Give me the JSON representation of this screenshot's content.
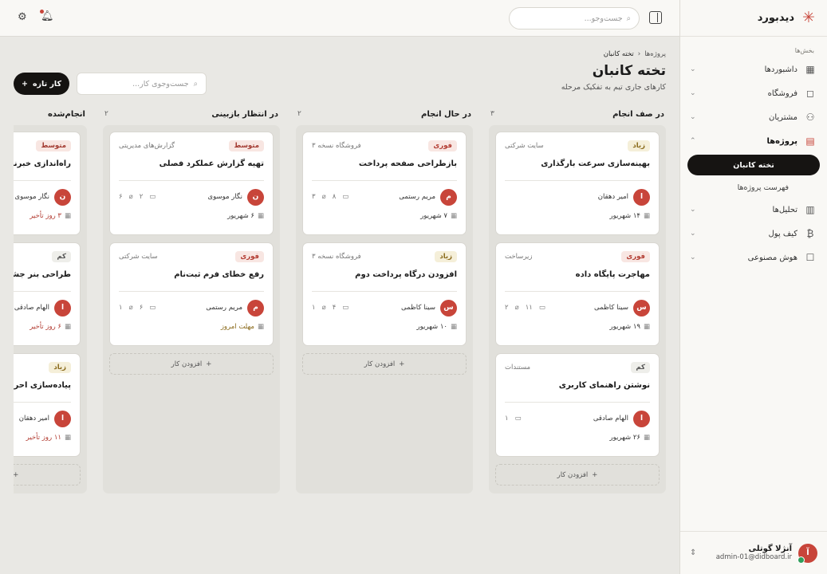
{
  "app": {
    "name": "دیدبورد"
  },
  "sidebar": {
    "section_label": "بخش‌ها",
    "items": [
      {
        "label": "داشبوردها",
        "icon": "grid-icon"
      },
      {
        "label": "فروشگاه",
        "icon": "bag-icon"
      },
      {
        "label": "مشتریان",
        "icon": "users-icon"
      },
      {
        "label": "پروژه‌ها",
        "icon": "kanban-icon"
      },
      {
        "label": "تحلیل‌ها",
        "icon": "bar-chart-icon"
      },
      {
        "label": "کیف پول",
        "icon": "bitcoin-icon"
      },
      {
        "label": "هوش مصنوعی",
        "icon": "robot-icon"
      }
    ],
    "sub_items": [
      {
        "label": "تخته کانبان"
      },
      {
        "label": "فهرست پروژه‌ها"
      }
    ],
    "user": {
      "name": "آنژلا گوتلی",
      "email": "admin-01@didboard.ir",
      "initial": "آ"
    }
  },
  "topbar": {
    "search_placeholder": "جست‌وجو..."
  },
  "page": {
    "breadcrumb_parent": "پروژه‌ها",
    "breadcrumb_current": "تخته کانبان",
    "title": "تخته کانبان",
    "subtitle": "کارهای جاری تیم به تفکیک مرحله",
    "search_placeholder": "جست‌وجوی کار...",
    "new_task_label": "کار تازه",
    "add_card_label": "افزودن کار"
  },
  "columns": [
    {
      "title": "در صف انجام",
      "count": "۳",
      "cards": [
        {
          "tag": "زیاد",
          "project": "سایت شرکتی",
          "title": "بهینه‌سازی سرعت بارگذاری",
          "assignee": "امیر دهقان",
          "initial": "ا",
          "comments": "",
          "attachments": "",
          "date": "۱۴ شهریور"
        },
        {
          "tag": "فوری",
          "project": "زیرساخت",
          "title": "مهاجرت پایگاه داده",
          "assignee": "سینا کاظمی",
          "initial": "س",
          "comments": "۱۱",
          "attachments": "۲",
          "date": "۱۹ شهریور"
        },
        {
          "tag": "کم",
          "project": "مستندات",
          "title": "نوشتن راهنمای کاربری",
          "assignee": "الهام صادقی",
          "initial": "ا",
          "comments": "۱",
          "attachments": "",
          "date": "۲۶ شهریور"
        }
      ]
    },
    {
      "title": "در حال انجام",
      "count": "۲",
      "cards": [
        {
          "tag": "فوری",
          "project": "فروشگاه نسخه ۳",
          "title": "بازطراحی صفحه پرداخت",
          "assignee": "مریم رستمی",
          "initial": "م",
          "comments": "۸",
          "attachments": "۳",
          "date": "۷ شهریور"
        },
        {
          "tag": "زیاد",
          "project": "فروشگاه نسخه ۳",
          "title": "افزودن درگاه پرداخت دوم",
          "assignee": "سینا کاظمی",
          "initial": "س",
          "comments": "۴",
          "attachments": "۱",
          "date": "۱۰ شهریور"
        }
      ]
    },
    {
      "title": "در انتظار بازبینی",
      "count": "۲",
      "cards": [
        {
          "tag": "متوسط",
          "project": "گزارش‌های مدیریتی",
          "title": "تهیه گزارش عملکرد فصلی",
          "assignee": "نگار موسوی",
          "initial": "ن",
          "comments": "۲",
          "attachments": "۶",
          "date": "۶ شهریور"
        },
        {
          "tag": "فوری",
          "project": "سایت شرکتی",
          "title": "رفع خطای فرم ثبت‌نام",
          "assignee": "مریم رستمی",
          "initial": "م",
          "comments": "۶",
          "attachments": "۱",
          "date": "مهلت امروز"
        }
      ]
    },
    {
      "title": "انجام‌شده",
      "count": "",
      "cards": [
        {
          "tag": "متوسط",
          "project": "",
          "title": "راه‌اندازی خبرنامه ایمیلی",
          "assignee": "نگار موسوی",
          "initial": "ن",
          "comments": "",
          "attachments": "",
          "date": "۳ روز تأخیر"
        },
        {
          "tag": "کم",
          "project": "",
          "title": "طراحی بنر جشنواره",
          "assignee": "الهام صادقی",
          "initial": "ا",
          "comments": "",
          "attachments": "",
          "date": "۶ روز تأخیر"
        },
        {
          "tag": "زیاد",
          "project": "",
          "title": "پیاده‌سازی احراز هویت",
          "assignee": "امیر دهقان",
          "initial": "ا",
          "comments": "",
          "attachments": "",
          "date": "۱۱ روز تأخیر"
        }
      ]
    }
  ],
  "colors": {
    "accent": "#c8453a",
    "dark": "#151311",
    "bg": "#e9e8e4"
  }
}
